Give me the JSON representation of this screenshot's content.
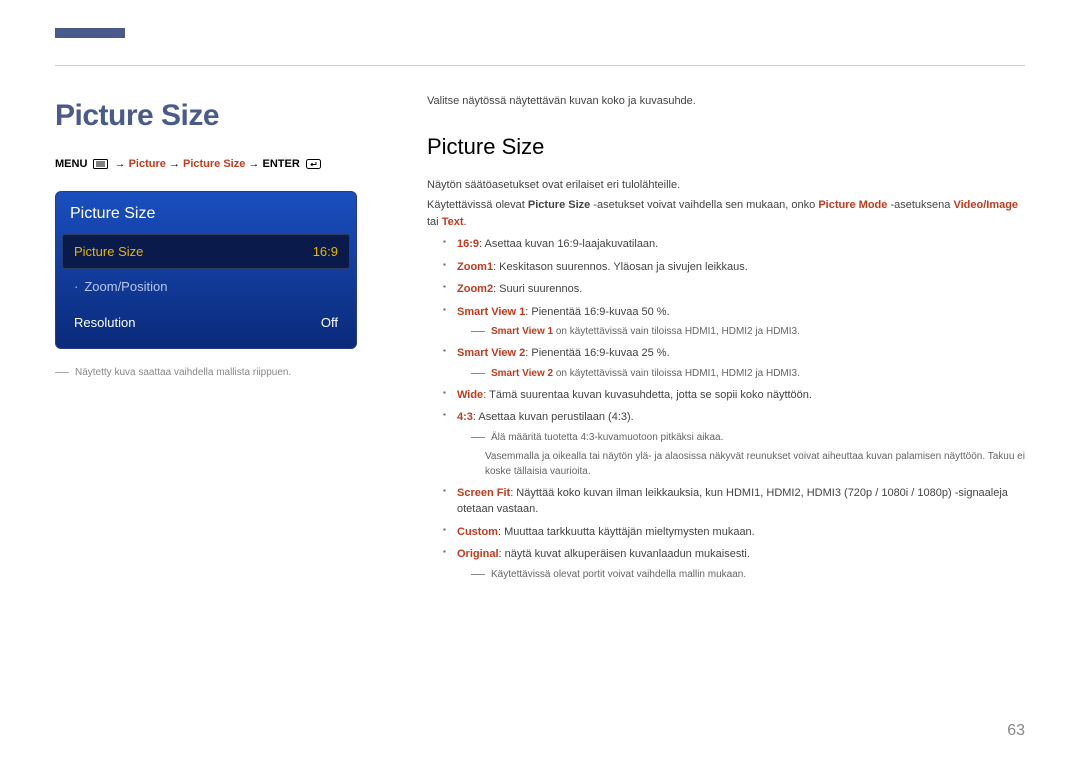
{
  "page_number": "63",
  "title": "Picture Size",
  "breadcrumb": {
    "menu": "MENU",
    "arrow": " → ",
    "picture": "Picture",
    "picture_size": "Picture Size",
    "enter": "ENTER"
  },
  "osd": {
    "header": "Picture Size",
    "rows": [
      {
        "label": "Picture Size",
        "value": "16:9",
        "selected": true
      },
      {
        "label": "Zoom/Position",
        "value": "",
        "dim": true,
        "prefix": "·"
      },
      {
        "label": "Resolution",
        "value": "Off"
      }
    ]
  },
  "img_note": "Näytetty kuva saattaa vaihdella mallista riippuen.",
  "intro": "Valitse näytössä näytettävän kuvan koko ja kuvasuhde.",
  "section_title": "Picture Size",
  "p1": "Näytön säätöasetukset ovat erilaiset eri tulolähteille.",
  "p2_a": "Käytettävissä olevat ",
  "p2_b": "Picture Size",
  "p2_c": " -asetukset voivat vaihdella sen mukaan, onko ",
  "p2_d": "Picture Mode",
  "p2_e": " -asetuksena ",
  "p2_f": "Video/Image",
  "p2_g": " tai ",
  "p2_h": "Text",
  "p2_i": ".",
  "li1_a": "16:9",
  "li1_b": ": Asettaa kuvan ",
  "li1_c": "16:9",
  "li1_d": "-laajakuvatilaan.",
  "li2_a": "Zoom1",
  "li2_b": ": Keskitason suurennos. Yläosan ja sivujen leikkaus.",
  "li3_a": "Zoom2",
  "li3_b": ": Suuri suurennos.",
  "li4_a": "Smart View 1",
  "li4_b": ": Pienentää ",
  "li4_c": "16:9",
  "li4_d": "-kuvaa 50 %.",
  "sn4_a": "Smart View 1",
  "sn4_b": " on käytettävissä vain tiloissa ",
  "sn4_c": "HDMI1",
  "sn4_d": ", ",
  "sn4_e": "HDMI2",
  "sn4_f": " ja ",
  "sn4_g": "HDMI3",
  "sn4_h": ".",
  "li5_a": "Smart View 2",
  "li5_b": ": Pienentää ",
  "li5_c": "16:9",
  "li5_d": "-kuvaa 25 %.",
  "sn5_a": "Smart View 2",
  "sn5_b": " on käytettävissä vain tiloissa ",
  "sn5_c": "HDMI1",
  "sn5_d": ", ",
  "sn5_e": "HDMI2",
  "sn5_f": " ja ",
  "sn5_g": "HDMI3",
  "sn5_h": ".",
  "li6_a": "Wide",
  "li6_b": ": Tämä suurentaa kuvan kuvasuhdetta, jotta se sopii koko näyttöön.",
  "li7_a": "4:3",
  "li7_b": ": Asettaa kuvan perustilaan (",
  "li7_c": "4:3",
  "li7_d": ").",
  "sn7_a": "Älä määritä tuotetta ",
  "sn7_b": "4:3",
  "sn7_c": "-kuvamuotoon pitkäksi aikaa.",
  "sn7_body": "Vasemmalla ja oikealla tai näytön ylä- ja alaosissa näkyvät reunukset voivat aiheuttaa kuvan palamisen näyttöön. Takuu ei koske tällaisia vaurioita.",
  "li8_a": "Screen Fit",
  "li8_b": ": Näyttää koko kuvan ilman leikkauksia, kun ",
  "li8_c": "HDMI1",
  "li8_d": ", ",
  "li8_e": "HDMI2",
  "li8_f": ", ",
  "li8_g": "HDMI3",
  "li8_h": " (720p / 1080i / 1080p) -signaaleja otetaan vastaan.",
  "li9_a": "Custom",
  "li9_b": ": Muuttaa tarkkuutta käyttäjän mieltymysten mukaan.",
  "li10_a": "Original",
  "li10_b": ": näytä kuvat alkuperäisen kuvanlaadun mukaisesti.",
  "sn10": "Käytettävissä olevat portit voivat vaihdella mallin mukaan."
}
